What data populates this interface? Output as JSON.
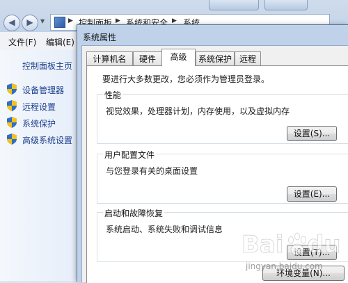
{
  "explorer": {
    "breadcrumb": [
      "控制面板",
      "系统和安全",
      "系统"
    ],
    "menu": [
      "文件(F)",
      "编辑(E)"
    ],
    "nav_home": "控制面板主页",
    "nav_links": [
      "设备管理器",
      "远程设置",
      "系统保护",
      "高级系统设置"
    ]
  },
  "dialog": {
    "title": "系统属性",
    "tabs": [
      "计算机名",
      "硬件",
      "高级",
      "系统保护",
      "远程"
    ],
    "active_tab": "高级",
    "intro": "要进行大多数更改，您必须作为管理员登录。",
    "performance": {
      "legend": "性能",
      "desc": "视觉效果，处理器计划，内存使用，以及虚拟内存",
      "button": "设置(S)..."
    },
    "profiles": {
      "legend": "用户配置文件",
      "desc": "与您登录有关的桌面设置",
      "button": "设置(E)..."
    },
    "startup": {
      "legend": "启动和故障恢复",
      "desc": "系统启动、系统失败和调试信息",
      "button": "设置(T)..."
    },
    "env_button": "环境变量(N)..."
  },
  "watermark": {
    "brand": "Baidu",
    "sub": "jingyan.baidu.com"
  },
  "colors": {
    "link": "#1c3f8c",
    "shield_blue": "#2f6fc4",
    "shield_yellow": "#f2c21b"
  }
}
